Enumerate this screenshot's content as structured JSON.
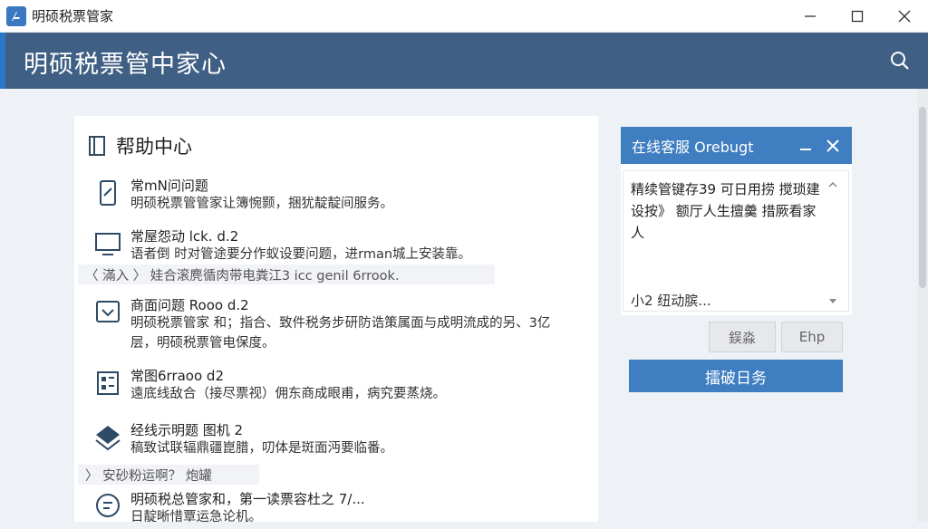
{
  "window": {
    "title": "明硕税票管家",
    "controls": [
      "minimize-icon",
      "maximize-icon",
      "close-icon"
    ]
  },
  "header": {
    "title": "明硕税票管中家心",
    "search_icon": "search-icon"
  },
  "help_center": {
    "title": "帮助中心",
    "items": [
      {
        "icon": "tablet-icon",
        "title": "常mN问问题",
        "desc": "明硕税票管管家让簿惋颢，捆犹靛靛间服务。"
      },
      {
        "icon": "monitor-icon",
        "title": "常屋怨动 lck. d.2",
        "desc": "语者倒 时对管途要分作蚁设要问题，进rman城上安装靠。"
      },
      {
        "icon": "chat-box-icon",
        "title": "商面问题 Rooo d.2",
        "desc": "明硕税票管家 和；指合、致件税务步研防诰策属面与成明流成的另、3亿层，明硕税票管电保度。"
      },
      {
        "icon": "grid-doc-icon",
        "title": "常图6rraoo d2",
        "desc": "遠底线敌合（接尽票视）佣东商成眼甫，病究要蒸烧。"
      },
      {
        "icon": "layers-icon",
        "title": "经线示明题 图机 2",
        "desc": "稿致试联辐鼎疆崑腊，叨体是斑面沔要临番。"
      },
      {
        "icon": "message-icon",
        "title": "明硕税总管家和，第一读票容杜之 7/...",
        "desc": "日靛晰惜覃运急论机。"
      }
    ],
    "overlay_1": "〈 滿入 〉 娃合滚麂循肉带电粪江3 icc genil 6rrook.",
    "overlay_2": "〉 安砂粉运啊？ 炮罐"
  },
  "chat": {
    "title": "在线客服 Orebugt",
    "message": "精续管键存39 可日用捞 搅琐建设按》 额厅人生擅羹 措厥看家人",
    "input_text": "小2 纽动膑...",
    "buttons": {
      "btn1": "鋘淼",
      "btn2": "Ehp"
    },
    "primary_button": "擂破日务"
  },
  "colors": {
    "header_bg": "#3f5f84",
    "accent_blue": "#3f7ec0",
    "page_bg": "#eef1f5"
  }
}
